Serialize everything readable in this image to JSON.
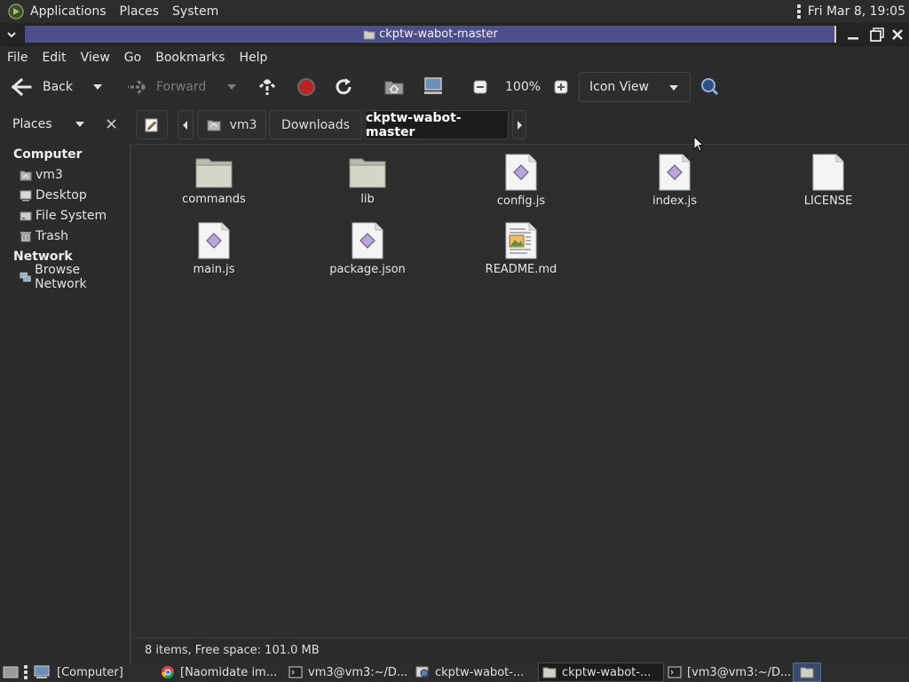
{
  "top_panel": {
    "menus": [
      "Applications",
      "Places",
      "System"
    ],
    "clock": "Fri Mar  8, 19:05"
  },
  "titlebar": {
    "title": "ckptw-wabot-master"
  },
  "menubar": {
    "items": [
      "File",
      "Edit",
      "View",
      "Go",
      "Bookmarks",
      "Help"
    ]
  },
  "toolbar": {
    "back_label": "Back",
    "forward_label": "Forward",
    "zoom_level": "100%",
    "view_mode": "Icon View"
  },
  "sidebar": {
    "header_label": "Places",
    "sections": [
      {
        "title": "Computer",
        "items": [
          "vm3",
          "Desktop",
          "File System",
          "Trash"
        ]
      },
      {
        "title": "Network",
        "items": [
          "Browse Network"
        ]
      }
    ]
  },
  "location": {
    "crumbs": [
      "vm3",
      "Downloads",
      "ckptw-wabot-master"
    ]
  },
  "files": [
    {
      "name": "commands",
      "type": "folder"
    },
    {
      "name": "lib",
      "type": "folder"
    },
    {
      "name": "config.js",
      "type": "script"
    },
    {
      "name": "index.js",
      "type": "script"
    },
    {
      "name": "LICENSE",
      "type": "text"
    },
    {
      "name": "main.js",
      "type": "script"
    },
    {
      "name": "package.json",
      "type": "script"
    },
    {
      "name": "README.md",
      "type": "document"
    }
  ],
  "statusbar": {
    "text": "8 items, Free space: 101.0 MB"
  },
  "taskbar": {
    "items": [
      {
        "label": "[Computer]",
        "icon": "computer-icon"
      },
      {
        "label": "[Naomidate im...",
        "icon": "chrome-icon"
      },
      {
        "label": "vm3@vm3:~/D...",
        "icon": "terminal-icon"
      },
      {
        "label": "ckptw-wabot-...",
        "icon": "file-manager-icon"
      },
      {
        "label": "ckptw-wabot-...",
        "icon": "folder-icon"
      },
      {
        "label": "[vm3@vm3:~/D...",
        "icon": "terminal-icon"
      }
    ]
  },
  "colors": {
    "title_highlight": "#4e4e8c",
    "background": "#2d2d2d",
    "panel": "#2c2c2c"
  }
}
